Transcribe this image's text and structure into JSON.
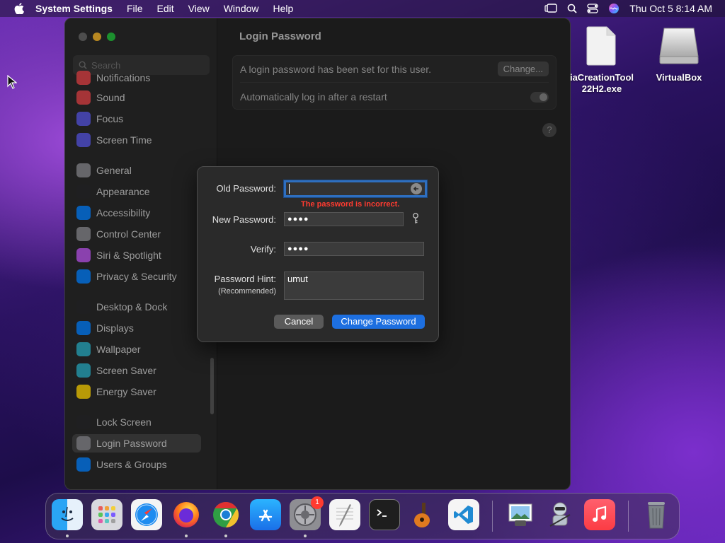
{
  "menubar": {
    "app_name": "System Settings",
    "items": [
      "File",
      "Edit",
      "View",
      "Window",
      "Help"
    ],
    "clock": "Thu Oct 5  8:14 AM"
  },
  "desktop": {
    "icons": [
      {
        "label_line1": "iaCreationTool",
        "label_line2": "22H2.exe"
      },
      {
        "label_line1": "VirtualBox",
        "label_line2": ""
      }
    ]
  },
  "sidebar": {
    "search_placeholder": "Search",
    "items": [
      {
        "label": "Notifications",
        "color": "#e5484d"
      },
      {
        "label": "Sound",
        "color": "#e5484d"
      },
      {
        "label": "Focus",
        "color": "#5e5ce6"
      },
      {
        "label": "Screen Time",
        "color": "#5e5ce6"
      },
      {
        "label": "General",
        "color": "#8e8e93"
      },
      {
        "label": "Appearance",
        "color": "#2c2c2e"
      },
      {
        "label": "Accessibility",
        "color": "#0a84ff"
      },
      {
        "label": "Control Center",
        "color": "#8e8e93"
      },
      {
        "label": "Siri & Spotlight",
        "color": "#bf5af2"
      },
      {
        "label": "Privacy & Security",
        "color": "#0a84ff"
      },
      {
        "label": "Desktop & Dock",
        "color": "#2c2c2e"
      },
      {
        "label": "Displays",
        "color": "#0a84ff"
      },
      {
        "label": "Wallpaper",
        "color": "#30b0c7"
      },
      {
        "label": "Screen Saver",
        "color": "#30b0c7"
      },
      {
        "label": "Energy Saver",
        "color": "#ffd60a"
      },
      {
        "label": "Lock Screen",
        "color": "#2c2c2e"
      },
      {
        "label": "Login Password",
        "color": "#8e8e93"
      },
      {
        "label": "Users & Groups",
        "color": "#0a84ff"
      }
    ],
    "selected": "Login Password"
  },
  "content": {
    "title": "Login Password",
    "row1_text": "A login password has been set for this user.",
    "change_label": "Change...",
    "row2_text": "Automatically log in after a restart",
    "help_label": "?"
  },
  "dialog": {
    "old_label": "Old Password:",
    "error": "The password is incorrect.",
    "new_label": "New Password:",
    "new_value": "●●●●",
    "verify_label": "Verify:",
    "verify_value": "●●●●",
    "hint_label": "Password Hint:",
    "hint_sub": "(Recommended)",
    "hint_value": "umut",
    "cancel_label": "Cancel",
    "primary_label": "Change Password"
  },
  "dock": {
    "settings_badge": "1"
  }
}
